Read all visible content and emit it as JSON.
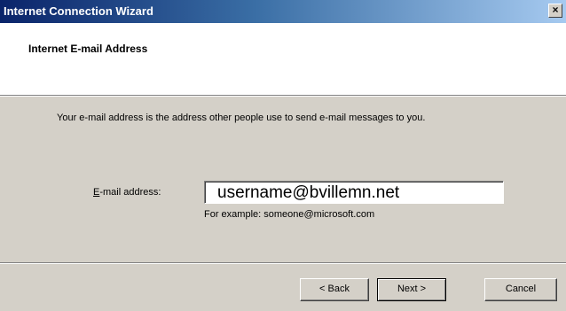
{
  "window": {
    "title": "Internet Connection Wizard",
    "close_glyph": "×"
  },
  "header": {
    "title": "Internet E-mail Address"
  },
  "main": {
    "description": "Your e-mail address is the address other people use to send e-mail messages to you.",
    "email_label_accel": "E",
    "email_label_rest": "-mail address:",
    "email_value": "username@bvillemn.net",
    "example_text": "For example: someone@microsoft.com"
  },
  "buttons": {
    "back": "< Back",
    "next": "Next >",
    "cancel": "Cancel"
  }
}
